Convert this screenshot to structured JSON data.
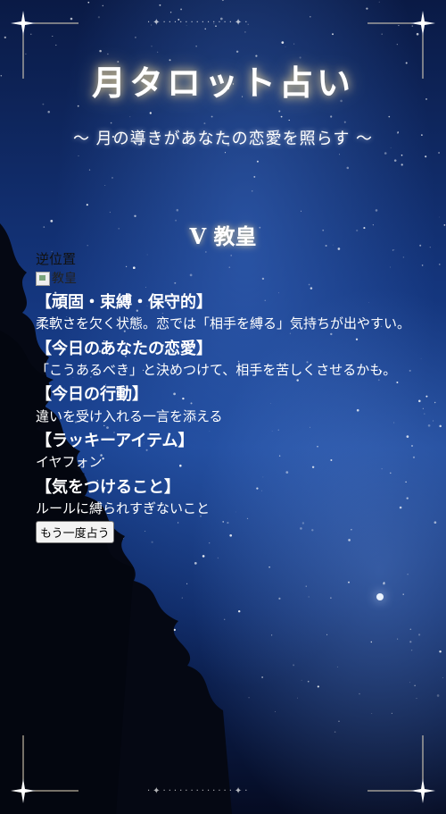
{
  "header": {
    "title": "月タロット占い",
    "subtitle": "〜 月の導きがあなたの恋愛を照らす 〜"
  },
  "card": {
    "name": "Ⅴ 教皇",
    "orientation": "逆位置",
    "image_alt": "教皇"
  },
  "sections": [
    {
      "title": "【頑固・束縛・保守的】",
      "body": "柔軟さを欠く状態。恋では「相手を縛る」気持ちが出やすい。"
    },
    {
      "title": "【今日のあなたの恋愛】",
      "body": "「こうあるべき」と決めつけて、相手を苦しくさせるかも。"
    },
    {
      "title": "【今日の行動】",
      "body": "違いを受け入れる一言を添える"
    },
    {
      "title": "【ラッキーアイテム】",
      "body": "イヤフォン"
    },
    {
      "title": "【気をつけること】",
      "body": "ルールに縛られすぎないこと"
    }
  ],
  "actions": {
    "retry_label": "もう一度占う"
  },
  "colors": {
    "sky_top": "#0a1a45",
    "sky_mid": "#1b4493",
    "glow": "#ffe6a0"
  }
}
